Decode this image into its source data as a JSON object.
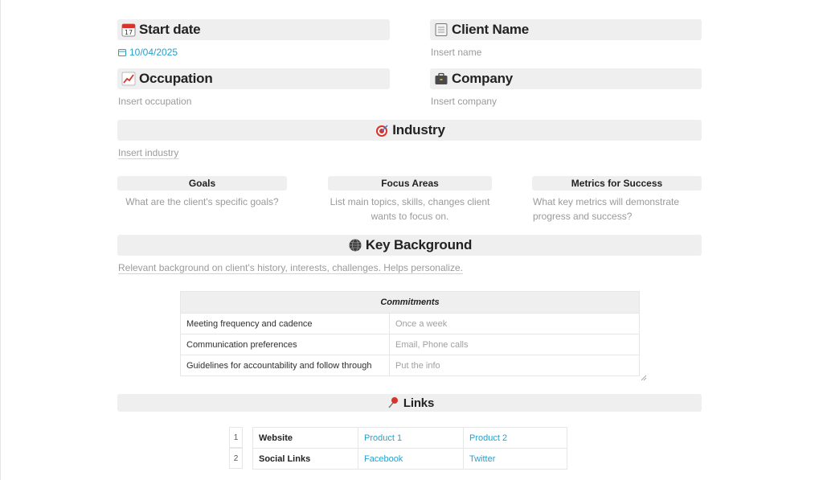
{
  "start_date": {
    "title": "Start date",
    "value": "10/04/2025"
  },
  "client_name": {
    "title": "Client Name",
    "placeholder": "Insert name"
  },
  "occupation": {
    "title": "Occupation",
    "placeholder": "Insert occupation"
  },
  "company": {
    "title": "Company",
    "placeholder": "Insert company"
  },
  "industry": {
    "title": "Industry",
    "placeholder": "Insert industry"
  },
  "columns": [
    {
      "title": "Goals",
      "text": "What are the client's specific goals?"
    },
    {
      "title": "Focus Areas",
      "text": "List main topics, skills, changes client wants to focus on."
    },
    {
      "title": "Metrics for Success",
      "text": "What key metrics will demonstrate progress and success?"
    }
  ],
  "key_background": {
    "title": "Key Background",
    "text": "Relevant background on client's history, interests, challenges. Helps personalize."
  },
  "commitments": {
    "header": "Commitments",
    "rows": [
      {
        "key": "Meeting frequency and cadence",
        "value": "Once a week"
      },
      {
        "key": "Communication preferences",
        "value": "Email, Phone calls"
      },
      {
        "key": "Guidelines for accountability and follow through",
        "value": "Put the info"
      }
    ]
  },
  "links": {
    "title": "Links",
    "rows": [
      {
        "num": "1",
        "label": "Website",
        "a": "Product 1",
        "b": "Product 2"
      },
      {
        "num": "2",
        "label": "Social Links",
        "a": "Facebook",
        "b": "Twitter"
      }
    ]
  },
  "colors": {
    "accent_link": "#2aa0c8",
    "header_bg": "#efefef",
    "placeholder": "#9a9a9a"
  },
  "icons": {
    "start_date": "calendar-icon",
    "client_name": "notepad-icon",
    "occupation": "chart-increasing-icon",
    "company": "briefcase-icon",
    "industry": "target-icon",
    "key_background": "globe-icon",
    "links": "pushpin-icon"
  }
}
